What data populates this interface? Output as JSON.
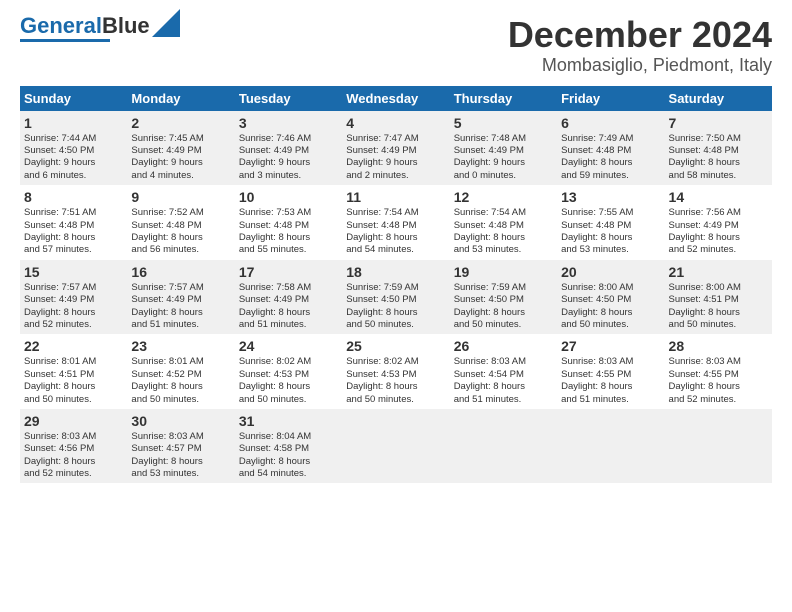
{
  "logo": {
    "part1": "General",
    "part2": "Blue"
  },
  "title": "December 2024",
  "subtitle": "Mombasiglio, Piedmont, Italy",
  "headers": [
    "Sunday",
    "Monday",
    "Tuesday",
    "Wednesday",
    "Thursday",
    "Friday",
    "Saturday"
  ],
  "weeks": [
    [
      {
        "day": "1",
        "info": "Sunrise: 7:44 AM\nSunset: 4:50 PM\nDaylight: 9 hours\nand 6 minutes."
      },
      {
        "day": "2",
        "info": "Sunrise: 7:45 AM\nSunset: 4:49 PM\nDaylight: 9 hours\nand 4 minutes."
      },
      {
        "day": "3",
        "info": "Sunrise: 7:46 AM\nSunset: 4:49 PM\nDaylight: 9 hours\nand 3 minutes."
      },
      {
        "day": "4",
        "info": "Sunrise: 7:47 AM\nSunset: 4:49 PM\nDaylight: 9 hours\nand 2 minutes."
      },
      {
        "day": "5",
        "info": "Sunrise: 7:48 AM\nSunset: 4:49 PM\nDaylight: 9 hours\nand 0 minutes."
      },
      {
        "day": "6",
        "info": "Sunrise: 7:49 AM\nSunset: 4:48 PM\nDaylight: 8 hours\nand 59 minutes."
      },
      {
        "day": "7",
        "info": "Sunrise: 7:50 AM\nSunset: 4:48 PM\nDaylight: 8 hours\nand 58 minutes."
      }
    ],
    [
      {
        "day": "8",
        "info": "Sunrise: 7:51 AM\nSunset: 4:48 PM\nDaylight: 8 hours\nand 57 minutes."
      },
      {
        "day": "9",
        "info": "Sunrise: 7:52 AM\nSunset: 4:48 PM\nDaylight: 8 hours\nand 56 minutes."
      },
      {
        "day": "10",
        "info": "Sunrise: 7:53 AM\nSunset: 4:48 PM\nDaylight: 8 hours\nand 55 minutes."
      },
      {
        "day": "11",
        "info": "Sunrise: 7:54 AM\nSunset: 4:48 PM\nDaylight: 8 hours\nand 54 minutes."
      },
      {
        "day": "12",
        "info": "Sunrise: 7:54 AM\nSunset: 4:48 PM\nDaylight: 8 hours\nand 53 minutes."
      },
      {
        "day": "13",
        "info": "Sunrise: 7:55 AM\nSunset: 4:48 PM\nDaylight: 8 hours\nand 53 minutes."
      },
      {
        "day": "14",
        "info": "Sunrise: 7:56 AM\nSunset: 4:49 PM\nDaylight: 8 hours\nand 52 minutes."
      }
    ],
    [
      {
        "day": "15",
        "info": "Sunrise: 7:57 AM\nSunset: 4:49 PM\nDaylight: 8 hours\nand 52 minutes."
      },
      {
        "day": "16",
        "info": "Sunrise: 7:57 AM\nSunset: 4:49 PM\nDaylight: 8 hours\nand 51 minutes."
      },
      {
        "day": "17",
        "info": "Sunrise: 7:58 AM\nSunset: 4:49 PM\nDaylight: 8 hours\nand 51 minutes."
      },
      {
        "day": "18",
        "info": "Sunrise: 7:59 AM\nSunset: 4:50 PM\nDaylight: 8 hours\nand 50 minutes."
      },
      {
        "day": "19",
        "info": "Sunrise: 7:59 AM\nSunset: 4:50 PM\nDaylight: 8 hours\nand 50 minutes."
      },
      {
        "day": "20",
        "info": "Sunrise: 8:00 AM\nSunset: 4:50 PM\nDaylight: 8 hours\nand 50 minutes."
      },
      {
        "day": "21",
        "info": "Sunrise: 8:00 AM\nSunset: 4:51 PM\nDaylight: 8 hours\nand 50 minutes."
      }
    ],
    [
      {
        "day": "22",
        "info": "Sunrise: 8:01 AM\nSunset: 4:51 PM\nDaylight: 8 hours\nand 50 minutes."
      },
      {
        "day": "23",
        "info": "Sunrise: 8:01 AM\nSunset: 4:52 PM\nDaylight: 8 hours\nand 50 minutes."
      },
      {
        "day": "24",
        "info": "Sunrise: 8:02 AM\nSunset: 4:53 PM\nDaylight: 8 hours\nand 50 minutes."
      },
      {
        "day": "25",
        "info": "Sunrise: 8:02 AM\nSunset: 4:53 PM\nDaylight: 8 hours\nand 50 minutes."
      },
      {
        "day": "26",
        "info": "Sunrise: 8:03 AM\nSunset: 4:54 PM\nDaylight: 8 hours\nand 51 minutes."
      },
      {
        "day": "27",
        "info": "Sunrise: 8:03 AM\nSunset: 4:55 PM\nDaylight: 8 hours\nand 51 minutes."
      },
      {
        "day": "28",
        "info": "Sunrise: 8:03 AM\nSunset: 4:55 PM\nDaylight: 8 hours\nand 52 minutes."
      }
    ],
    [
      {
        "day": "29",
        "info": "Sunrise: 8:03 AM\nSunset: 4:56 PM\nDaylight: 8 hours\nand 52 minutes."
      },
      {
        "day": "30",
        "info": "Sunrise: 8:03 AM\nSunset: 4:57 PM\nDaylight: 8 hours\nand 53 minutes."
      },
      {
        "day": "31",
        "info": "Sunrise: 8:04 AM\nSunset: 4:58 PM\nDaylight: 8 hours\nand 54 minutes."
      },
      {
        "day": "",
        "info": ""
      },
      {
        "day": "",
        "info": ""
      },
      {
        "day": "",
        "info": ""
      },
      {
        "day": "",
        "info": ""
      }
    ]
  ]
}
